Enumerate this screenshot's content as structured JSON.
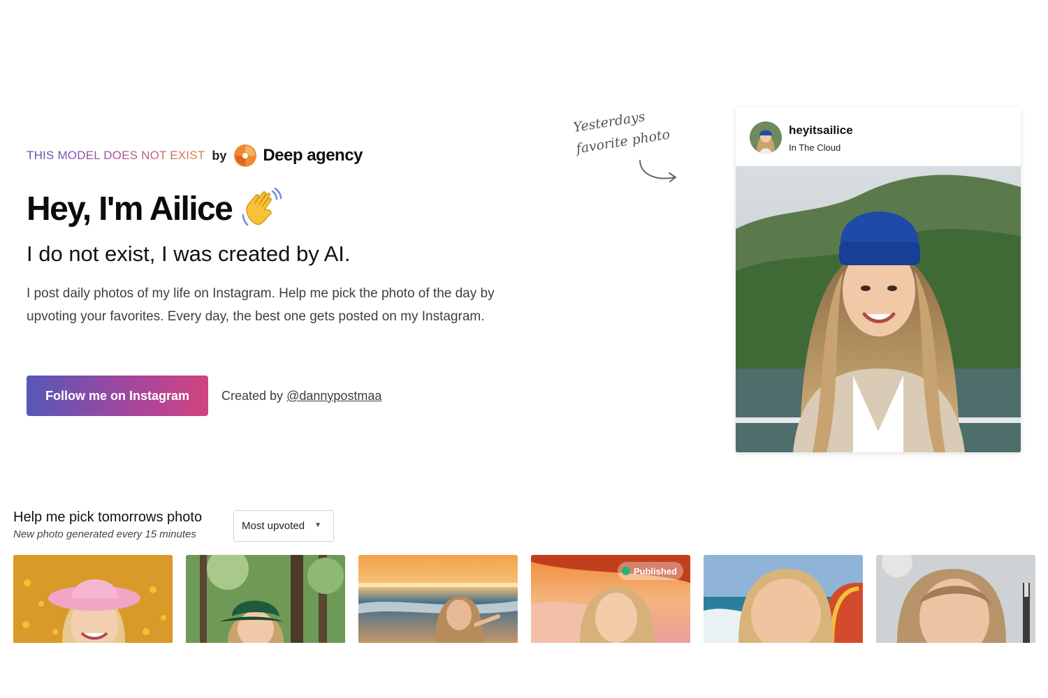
{
  "brand": {
    "tagline": "THIS MODEL DOES NOT EXIST",
    "by": "by",
    "agency_name": "Deep agency",
    "logo_icon": "deep-agency-logo-icon"
  },
  "hero": {
    "title": "Hey, I'm Ailice",
    "wave_icon": "waving-hand-icon",
    "subtitle": "I do not exist, I was created by AI.",
    "description": "I post daily photos of my life on Instagram. Help me pick the photo of the day by upvoting your favorites. Every day, the best one gets posted on my Instagram.",
    "cta_label": "Follow me on Instagram",
    "created_prefix": "Created by",
    "creator_handle": "@dannypostmaa"
  },
  "note": {
    "line1": "Yesterdays",
    "line2": "favorite photo",
    "arrow_icon": "curved-arrow-icon"
  },
  "instagram_card": {
    "username": "heyitsailice",
    "location": "In The Cloud"
  },
  "gallery": {
    "title": "Help me pick tomorrows photo",
    "subtitle": "New photo generated every 15 minutes",
    "sort_selected": "Most upvoted",
    "published_label": "Published",
    "status_color": "#22b573"
  },
  "colors": {
    "accent_gradient_start": "#5558b9",
    "accent_gradient_end": "#d04580",
    "beanie_blue": "#1e4aa8"
  }
}
